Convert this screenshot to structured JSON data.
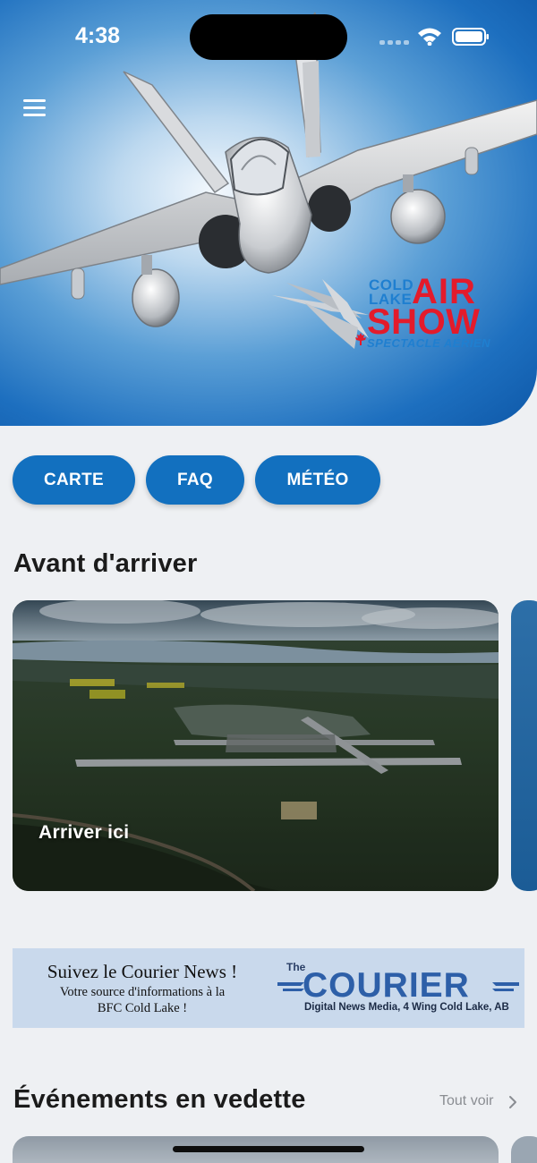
{
  "status_bar": {
    "time": "4:38"
  },
  "hero": {
    "logo": {
      "cold": "COLD",
      "lake": "LAKE",
      "air": "AIR",
      "show": "SHOW",
      "spectacle": "SPECTACLE AÉRIEN"
    }
  },
  "quick_links": [
    {
      "label": "CARTE"
    },
    {
      "label": "FAQ"
    },
    {
      "label": "MÉTÉO"
    }
  ],
  "before_arriving": {
    "title": "Avant d'arriver",
    "cards": [
      {
        "label": "Arriver ici"
      }
    ]
  },
  "ad_banner": {
    "line1": "Suivez le Courier News !",
    "line2": "Votre source d'informations à la",
    "line3": "BFC Cold Lake !",
    "the": "The",
    "brand": "COURIER",
    "tagline": "Digital News Media, 4 Wing Cold Lake, AB"
  },
  "featured_events": {
    "title": "Événements en vedette",
    "see_all": "Tout voir"
  },
  "colors": {
    "primary": "#1270bf",
    "logo_red": "#e31b2b",
    "logo_blue": "#1f7fd0",
    "background": "#eef0f3"
  },
  "icons": [
    "menu-icon",
    "wifi-icon",
    "battery-icon",
    "signal-icon",
    "chevron-right-icon"
  ]
}
